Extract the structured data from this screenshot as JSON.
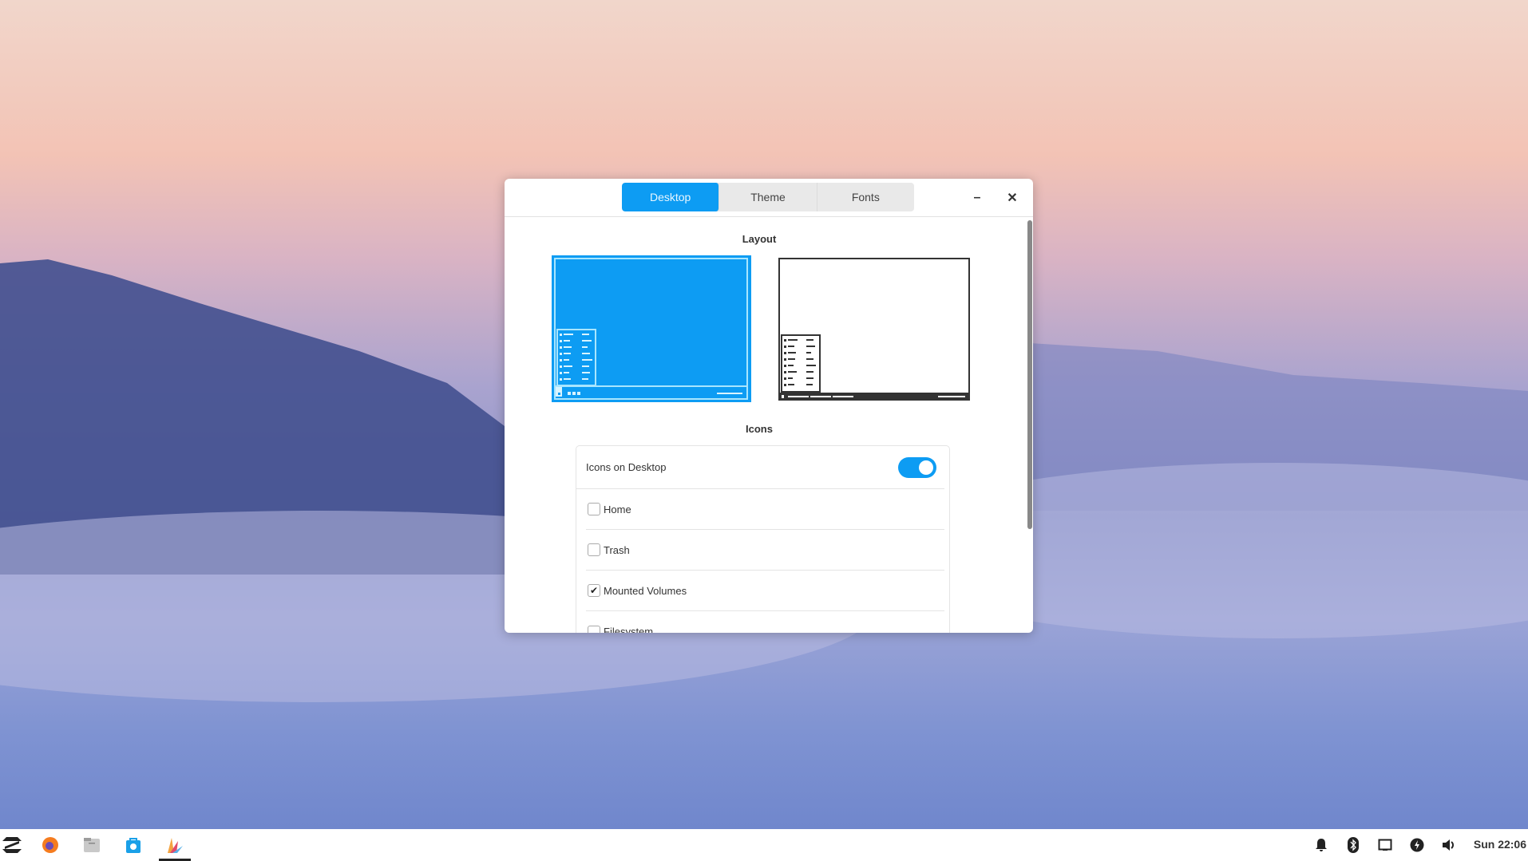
{
  "window": {
    "tabs": [
      {
        "label": "Desktop",
        "active": true
      },
      {
        "label": "Theme",
        "active": false
      },
      {
        "label": "Fonts",
        "active": false
      }
    ],
    "minimize_label": "–",
    "close_label": "✕"
  },
  "layout": {
    "title": "Layout",
    "options": [
      {
        "name": "windows-style",
        "selected": true
      },
      {
        "name": "classic-style",
        "selected": false
      }
    ]
  },
  "icons": {
    "title": "Icons",
    "toggle_label": "Icons on Desktop",
    "toggle_on": true,
    "items": [
      {
        "label": "Home",
        "checked": false
      },
      {
        "label": "Trash",
        "checked": false
      },
      {
        "label": "Mounted Volumes",
        "checked": true
      },
      {
        "label": "Filesystem",
        "checked": false
      }
    ]
  },
  "taskbar": {
    "apps": [
      "zorin-menu-icon",
      "firefox-icon",
      "files-icon",
      "software-store-icon",
      "appearance-icon"
    ],
    "tray": [
      "bell-icon",
      "bluetooth-icon",
      "display-icon",
      "power-icon",
      "volume-icon"
    ],
    "clock": "Sun 22:06"
  },
  "colors": {
    "accent": "#0d9cf3"
  }
}
